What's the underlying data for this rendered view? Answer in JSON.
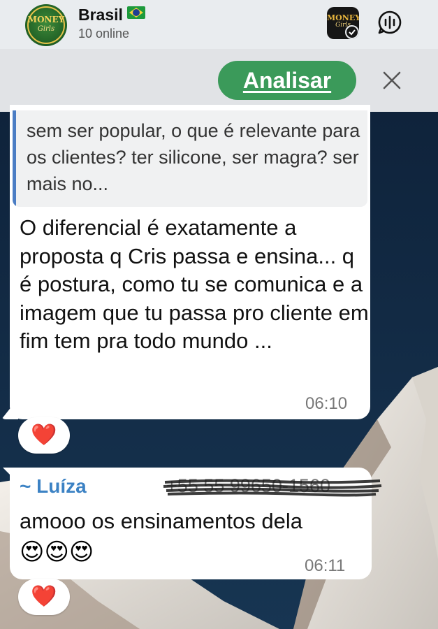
{
  "header": {
    "group_name": "Brasil",
    "online_status": "10 online",
    "group_logo_text": "MONEY",
    "group_logo_sub": "Girls",
    "app_icon_text": "MONEY",
    "app_icon_sub": "Girls"
  },
  "analyze_bar": {
    "button_label": "Analisar",
    "button_color": "#3b9a5a"
  },
  "messages": [
    {
      "quoted_text": "sem ser popular, o que é relevante para os clientes? ter silicone, ser magra? ser mais no...",
      "text": "O diferencial é exatamente a proposta q Cris passa e ensina... q é postura, como tu se comunica e a imagem que tu passa pro cliente em fim tem pra todo mundo ...",
      "time": "06:10",
      "reaction": "❤️"
    },
    {
      "sender": "~ Luíza",
      "sender_phone": "+55 55 99650-1560",
      "text": "amooo os ensinamentos dela",
      "emojis": "😍😍😍",
      "time": "06:11",
      "reaction": "❤️"
    }
  ]
}
